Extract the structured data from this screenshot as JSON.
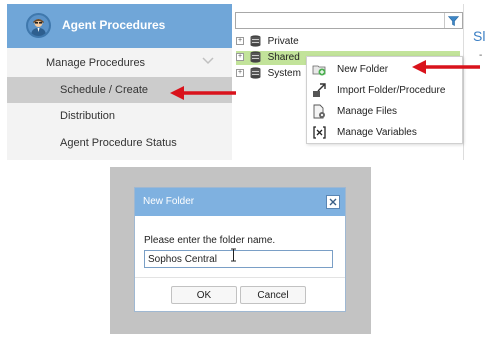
{
  "sidebar": {
    "title": "Agent Procedures",
    "items": [
      {
        "label": "Manage Procedures"
      },
      {
        "label": "Schedule / Create"
      },
      {
        "label": "Distribution"
      },
      {
        "label": "Agent Procedure Status"
      }
    ]
  },
  "tree": {
    "nodes": [
      {
        "label": "Private"
      },
      {
        "label": "Shared"
      },
      {
        "label": "System"
      }
    ]
  },
  "context_menu": {
    "items": [
      {
        "label": "New Folder",
        "icon": "new-folder-icon"
      },
      {
        "label": "Import Folder/Procedure",
        "icon": "import-icon"
      },
      {
        "label": "Manage Files",
        "icon": "manage-files-icon"
      },
      {
        "label": "Manage Variables",
        "icon": "manage-variables-icon"
      }
    ]
  },
  "right_pane": {
    "fragment": "Sl",
    "dash": "-"
  },
  "dialog": {
    "title": "New Folder",
    "prompt": "Please enter the folder name.",
    "input_value": "Sophos Central",
    "ok_label": "OK",
    "cancel_label": "Cancel"
  },
  "colors": {
    "sidebar_header": "#70a6d8",
    "selected_item": "#cccccc",
    "tree_selected": "#c2e39a",
    "dialog_title": "#7fb1e0",
    "arrow": "#d9121b"
  }
}
